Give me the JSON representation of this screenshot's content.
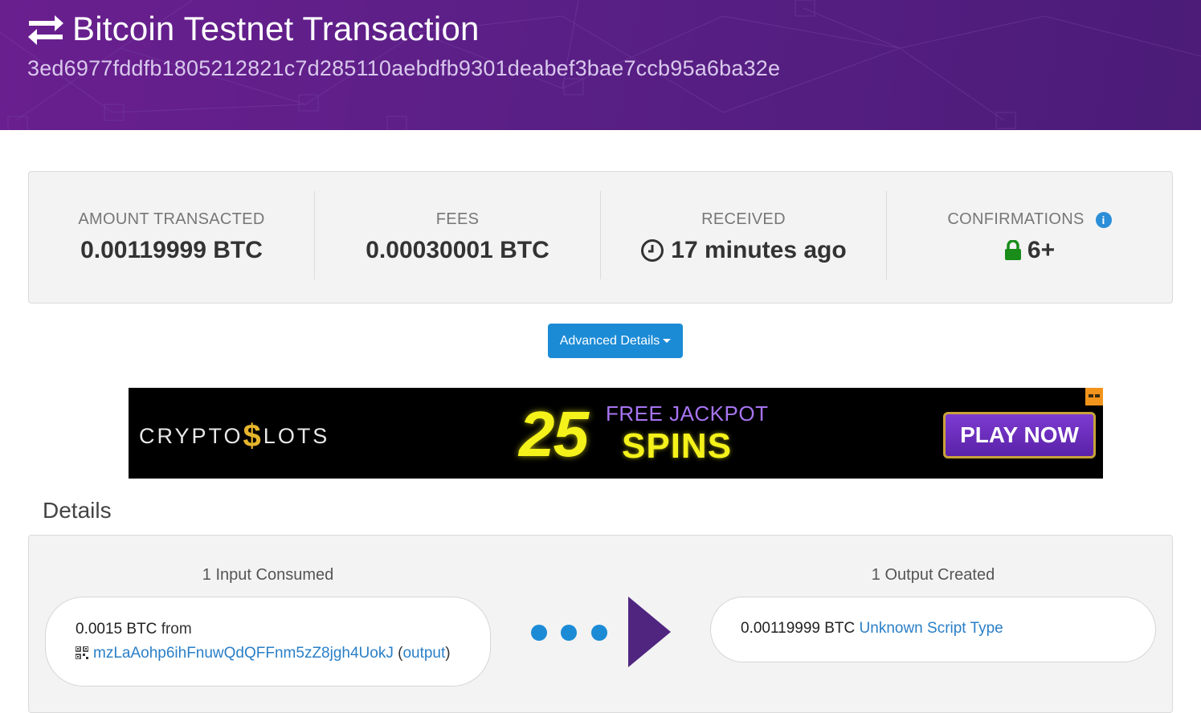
{
  "header": {
    "title": "Bitcoin Testnet Transaction",
    "tx_hash": "3ed6977fddfb1805212821c7d285110aebdfb9301deabef3bae7ccb95a6ba32e",
    "icon": "exchange-arrows-icon"
  },
  "summary": {
    "amount": {
      "label": "AMOUNT TRANSACTED",
      "value": "0.00119999 BTC"
    },
    "fees": {
      "label": "FEES",
      "value": "0.00030001 BTC"
    },
    "received": {
      "label": "RECEIVED",
      "value": "17 minutes ago",
      "icon": "clock-icon"
    },
    "confirmations": {
      "label": "CONFIRMATIONS",
      "value": "6+",
      "icon": "lock-icon",
      "info_icon": "info-icon"
    }
  },
  "advanced_button": {
    "label": "Advanced Details"
  },
  "ad": {
    "brand_pre": "CRYPTO",
    "brand_dollar": "$",
    "brand_post": "LOTS",
    "number": "25",
    "line1": "FREE JACKPOT",
    "line2": "SPINS",
    "cta": "PLAY NOW"
  },
  "details": {
    "heading": "Details",
    "inputs": {
      "heading": "1 Input Consumed",
      "items": [
        {
          "amount": "0.0015 BTC",
          "from_word": "from",
          "address": "mzLaAohp6ihFnuwQdQFFnm5zZ8jgh4UokJ",
          "output_link": "output"
        }
      ]
    },
    "outputs": {
      "heading": "1 Output Created",
      "items": [
        {
          "amount": "0.00119999 BTC",
          "script_type": "Unknown Script Type"
        }
      ]
    }
  },
  "colors": {
    "header_purple": "#5a1f86",
    "accent_blue": "#1b8bd6",
    "confirm_green": "#198c19",
    "arrow_purple": "#4f2580"
  }
}
